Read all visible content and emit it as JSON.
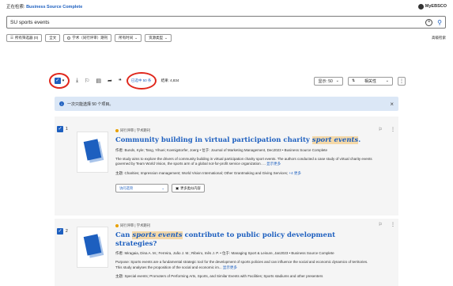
{
  "topbar": {
    "searching_label": "正在检索: ",
    "database": "Business Source Complete",
    "account": "MyEBSCO"
  },
  "search": {
    "value": "SU sports events"
  },
  "filters": {
    "all_filters": "所有筛选器 (0)",
    "fulltext": "全文",
    "peer_reviewed": "学术（同行评审）期刊",
    "all_time": "所有时间",
    "source_type": "资源类型",
    "advanced": "高级检索"
  },
  "toolbar": {
    "selected_badge": "已选中 50 条",
    "results_label": "结果: 4,834",
    "display_label": "显示: 50",
    "sort_label": "相关性"
  },
  "info": {
    "message": "一次只能选择 50 个项目。"
  },
  "results": [
    {
      "index": "1",
      "tag": "同行评审 | 学术期刊",
      "title_before": "Community building in virtual participation charity ",
      "title_hl": "sport events",
      "title_after": ".",
      "authors": "作者: Bunds, Kyle; Tang, Yihuei; Koenigstorfer, Joerg  • 位于: Journal of Marketing Management, Dec2023 • Business Source Complete",
      "abstract": "The study aims to explore the drivers of community building in virtual participation charity sport events. The authors conducted a case study of virtual charity events governed by Team World Vision, the sports arm of a global not-for-profit service organization. ...",
      "abstract_more": "显示更多",
      "subjects": "主题: Charities; Impression management; World Vision International; Other Grantmaking and Giving Services;",
      "subjects_more": "+4 更多",
      "access_label": "访问选项",
      "format_label": "更多类似内容"
    },
    {
      "index": "2",
      "tag": "同行评审 | 学术期刊",
      "title_before": "Can ",
      "title_hl": "sports events",
      "title_after": " contribute to public policy development strategies?",
      "authors": "作者: Miragaia, Dina A. M.; Ferreira, João J. M.; Ribeiro, Inês J. P.  • 位于: Managing Sport & Leisure, Jan2023 • Business Source Complete",
      "abstract": "Purpose: Sports events are a fundamental strategic tool for the development of sports policies and can influence the social and economic dynamics of territories. This study analyses the proposition of the social and economic im...",
      "abstract_more": "显示更多",
      "subjects": "主题: Special events; Promoters of Performing Arts, Sports, and Similar Events with Facilities; Sports stadiums and other presenters"
    }
  ]
}
